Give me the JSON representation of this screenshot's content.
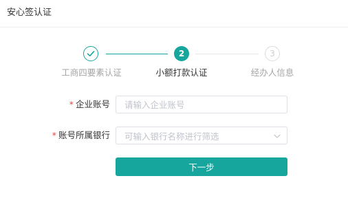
{
  "header": {
    "title": "安心签认证"
  },
  "steps": [
    {
      "number": "",
      "label": "工商四要素认证",
      "status": "completed"
    },
    {
      "number": "2",
      "label": "小额打款认证",
      "status": "active"
    },
    {
      "number": "3",
      "label": "经办人信息",
      "status": "pending"
    }
  ],
  "form": {
    "required_mark": "*",
    "account": {
      "label": "企业账号",
      "placeholder": "请输入企业账号",
      "value": ""
    },
    "bank": {
      "label": "账号所属银行",
      "placeholder": "可输入银行名称进行筛选",
      "value": ""
    }
  },
  "next_button": {
    "label": "下一步"
  },
  "colors": {
    "accent": "#17a69d",
    "required": "#e04646",
    "inactive": "#a6a6a6"
  }
}
